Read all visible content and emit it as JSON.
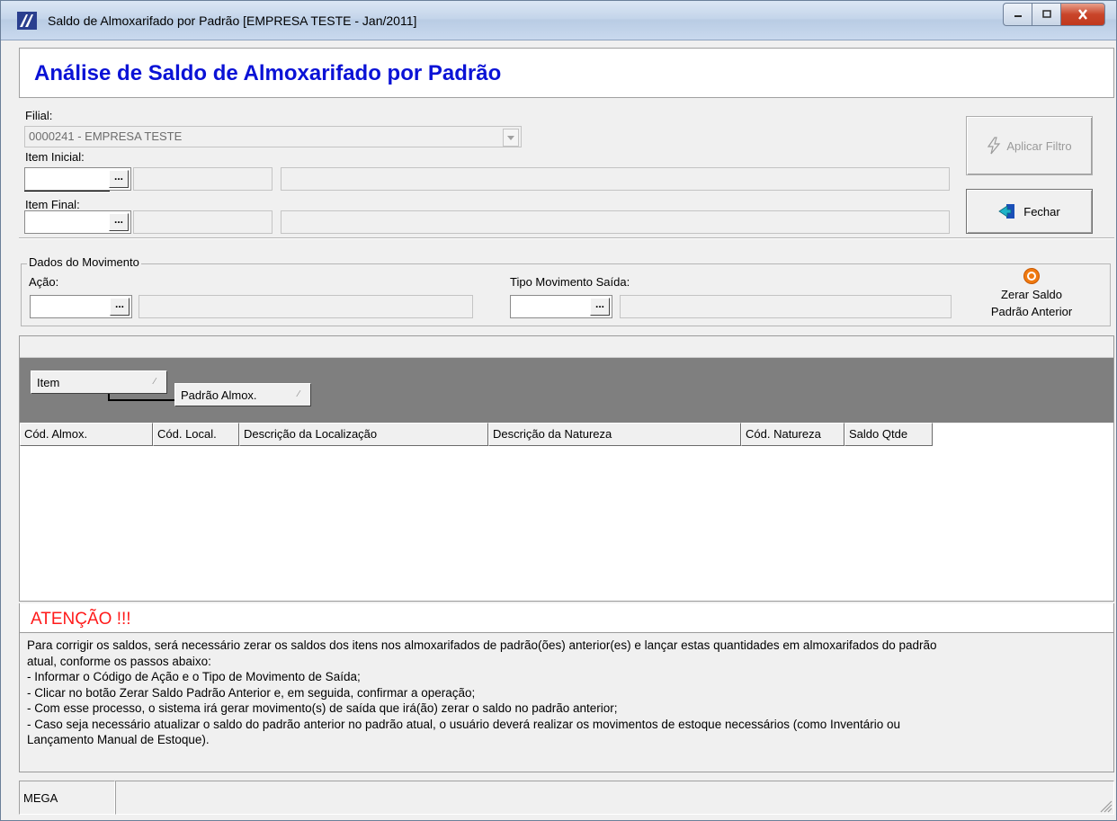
{
  "window": {
    "title": "Saldo de Almoxarifado por Padrão [EMPRESA TESTE - Jan/2011]"
  },
  "header": {
    "title": "Análise de Saldo de Almoxarifado por Padrão"
  },
  "filters": {
    "filial_label": "Filial:",
    "filial_value": "0000241 - EMPRESA TESTE",
    "item_inicial_label": "Item Inicial:",
    "item_final_label": "Item Final:",
    "lookup_button_label": "..."
  },
  "buttons": {
    "aplicar_filtro": "Aplicar Filtro",
    "fechar": "Fechar",
    "zerar_line1": "Zerar Saldo",
    "zerar_line2": "Padrão Anterior"
  },
  "movimento": {
    "group_title": "Dados do Movimento",
    "acao_label": "Ação:",
    "tipo_label": "Tipo Movimento Saída:"
  },
  "grid": {
    "group_chips": [
      "Item",
      "Padrão Almox."
    ],
    "columns": [
      "Cód. Almox.",
      "Cód. Local.",
      "Descrição da Localização",
      "Descrição da Natureza",
      "Cód. Natureza",
      "Saldo Qtde"
    ]
  },
  "notice": {
    "title": "ATENÇÃO !!!",
    "lines": [
      "Para corrigir os saldos, será necessário zerar os saldos dos itens nos almoxarifados de padrão(ões) anterior(es) e lançar estas quantidades em almoxarifados do padrão",
      "atual, conforme os passos abaixo:",
      " - Informar o Código de Ação e o Tipo de Movimento de Saída;",
      " - Clicar no botão Zerar Saldo Padrão Anterior e, em seguida, confirmar a operação;",
      " - Com esse processo, o sistema irá gerar movimento(s) de saída que irá(ão) zerar o saldo no padrão anterior;",
      " - Caso seja necessário atualizar o saldo do padrão anterior no padrão atual, o usuário deverá realizar os movimentos de estoque necessários (como Inventário ou",
      "Lançamento Manual de Estoque)."
    ]
  },
  "status": {
    "panel1": "MEGA"
  },
  "colors": {
    "title_blue": "#0a12d6",
    "attention_red": "#ff1a1a",
    "group_area_gray": "#7f7f7f"
  }
}
